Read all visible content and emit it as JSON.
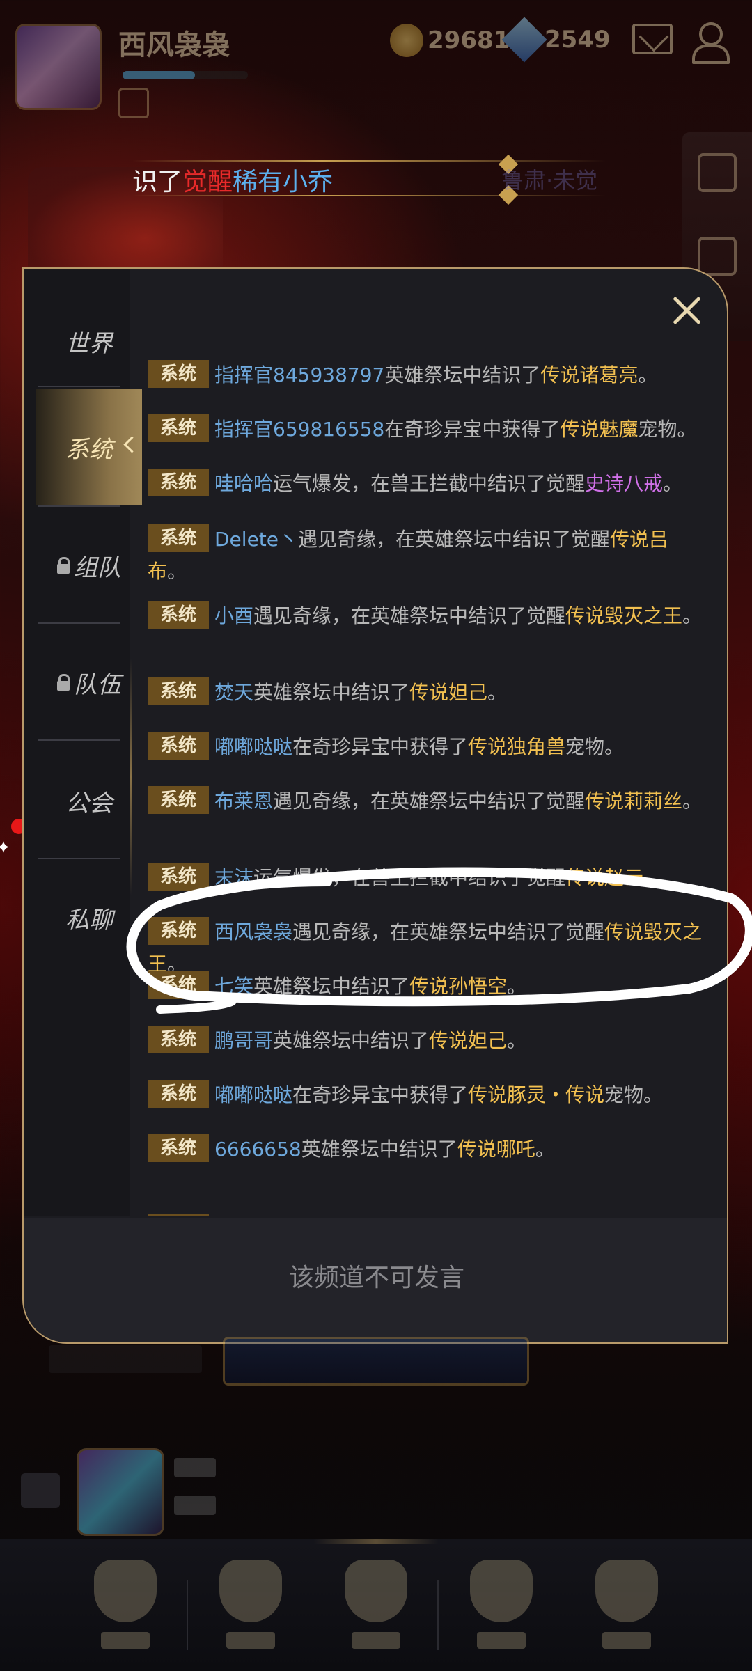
{
  "header": {
    "player_name": "西风袅袅",
    "gold": "29681",
    "gems": "2549",
    "xp_progress": 0.58
  },
  "ticker": {
    "text_1": "识了",
    "text_2": "觉醒",
    "text_3": "稀有小乔",
    "text_faded": "鲁肃·未觉"
  },
  "chat": {
    "tabs": [
      {
        "label": "世界",
        "locked": false
      },
      {
        "label": "系统",
        "locked": false,
        "active": true
      },
      {
        "label": "组队",
        "locked": true
      },
      {
        "label": "队伍",
        "locked": true
      },
      {
        "label": "公会",
        "locked": false
      },
      {
        "label": "私聊",
        "locked": false
      }
    ],
    "badge_label": "系统",
    "messages": [
      {
        "player": "指挥官845938797",
        "text": "英雄祭坛中结识了",
        "reward": "传说诸葛亮",
        "tail": "。"
      },
      {
        "player": "指挥官659816558",
        "text": "在奇珍异宝中获得了",
        "reward": "传说魅魔",
        "tail": "宠物。"
      },
      {
        "player": "哇哈哈",
        "text": "运气爆发，在兽王拦截中结识了觉醒",
        "reward": "史诗八戒",
        "tail": "。"
      },
      {
        "player": "Delete丶",
        "text": "遇见奇缘，在英雄祭坛中结识了觉醒",
        "reward": "传说吕布",
        "tail": "。"
      },
      {
        "player": "小酉",
        "text": "遇见奇缘，在英雄祭坛中结识了觉醒",
        "reward": "传说毁灭之王",
        "tail": "。"
      },
      {
        "player": "焚天",
        "text": "英雄祭坛中结识了",
        "reward": "传说妲己",
        "tail": "。"
      },
      {
        "player": "嘟嘟哒哒",
        "text": "在奇珍异宝中获得了",
        "reward": "传说独角兽",
        "tail": "宠物。"
      },
      {
        "player": "布莱恩",
        "text": "遇见奇缘，在英雄祭坛中结识了觉醒",
        "reward": "传说莉莉丝",
        "tail": "。"
      },
      {
        "player": "末沫",
        "text": "运气爆发，在兽王拦截中结识了觉醒",
        "reward": "传说赵云",
        "tail": "。"
      },
      {
        "player": "西风袅袅",
        "text": "遇见奇缘，在英雄祭坛中结识了觉醒",
        "reward": "传说毁灭之王",
        "tail": "。"
      },
      {
        "player": "七笑",
        "text": "英雄祭坛中结识了",
        "reward": "传说孙悟空",
        "tail": "。"
      },
      {
        "player": "鹏哥哥",
        "text": "英雄祭坛中结识了",
        "reward": "传说妲己",
        "tail": "。"
      },
      {
        "player": "嘟嘟哒哒",
        "text": "在奇珍异宝中获得了",
        "reward": "传说豚灵・传说",
        "tail": "宠物。"
      },
      {
        "player": "6666658",
        "text": "英雄祭坛中结识了",
        "reward": "传说哪吒",
        "tail": "。"
      }
    ],
    "input_placeholder": "该频道不可发言"
  },
  "colors": {
    "player_name": "#6ea8dc",
    "legendary": "#f2c050",
    "epic": "#d070e8",
    "badge_bg": "#6a4e1e",
    "panel_border": "#b89a6a"
  }
}
